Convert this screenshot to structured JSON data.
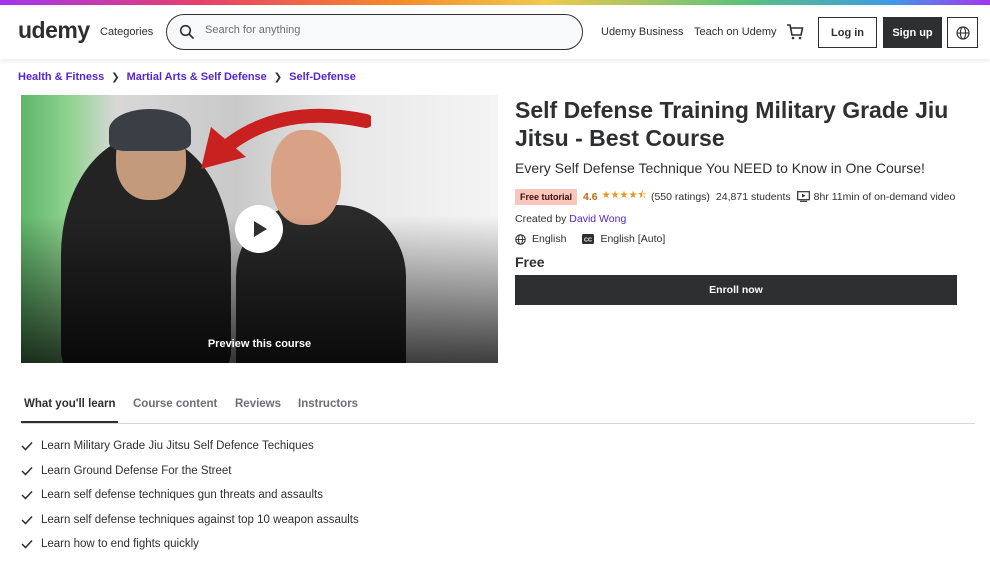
{
  "header": {
    "logo": "udemy",
    "categories_label": "Categories",
    "search_placeholder": "Search for anything",
    "business_label": "Udemy Business",
    "teach_label": "Teach on Udemy",
    "login_label": "Log in",
    "signup_label": "Sign up"
  },
  "breadcrumb": [
    "Health & Fitness",
    "Martial Arts & Self Defense",
    "Self-Defense"
  ],
  "preview": {
    "label": "Preview this course"
  },
  "course": {
    "title": "Self Defense Training Military Grade Jiu Jitsu - Best Course",
    "subtitle": "Every Self Defense Technique You NEED to Know in One Course!",
    "badge": "Free tutorial",
    "rating": "4.6",
    "stars": "★★★★⯪",
    "ratings_count": "(550 ratings)",
    "students": "24,871 students",
    "video_length": "8hr 11min of on-demand video",
    "created_by_label": "Created by",
    "instructor": "David Wong",
    "language": "English",
    "captions": "English [Auto]",
    "price": "Free",
    "enroll_label": "Enroll now"
  },
  "tabs": [
    "What you'll learn",
    "Course content",
    "Reviews",
    "Instructors"
  ],
  "learn_items": [
    "Learn Military Grade Jiu Jitsu Self Defence Techiques",
    "Learn Ground Defense For the Street",
    "Learn self defense techniques gun threats and assaults",
    "Learn self defense techniques against top 10 weapon assaults",
    "Learn how to end fights quickly"
  ],
  "colors": {
    "accent_purple": "#5624d0",
    "dark": "#2d2f31",
    "rating_orange": "#b4690e",
    "badge_bg": "#f8c6bd"
  }
}
